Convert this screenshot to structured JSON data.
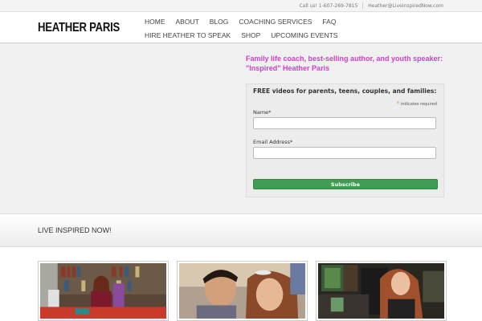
{
  "topbar": {
    "phone": "Call us! 1-607-269-7815",
    "email": "Heather@LiveInspiredNow.com"
  },
  "header": {
    "logo": "HEATHER PARIS"
  },
  "nav": {
    "items": [
      "HOME",
      "ABOUT",
      "BLOG",
      "COACHING SERVICES",
      "FAQ",
      "HIRE HEATHER TO SPEAK",
      "SHOP",
      "UPCOMING EVENTS"
    ]
  },
  "hero": {
    "tagline": "Family life coach, best-selling author, and youth speaker: \"Inspired\" Heather Paris",
    "form": {
      "title": "FREE videos for parents, teens, couples, and families:",
      "required_note": "indicates required",
      "name_label": "Name*",
      "email_label": "Email Address*",
      "submit": "Subscribe"
    }
  },
  "section": {
    "title": "LIVE INSPIRED NOW!"
  },
  "colors": {
    "accent": "#d63cc8",
    "button": "#3f9c52"
  }
}
